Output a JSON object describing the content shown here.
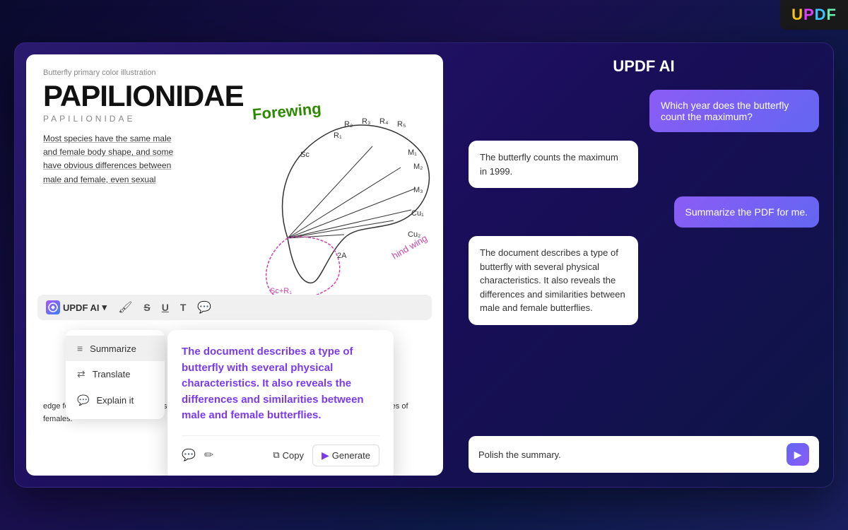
{
  "badge": {
    "u": "U",
    "p": "P",
    "d": "D",
    "f": "F"
  },
  "updf_ai_logo": "UPDF AI",
  "pdf": {
    "subtitle": "Butterfly primary color illustration",
    "title": "PAPILIONIDAE",
    "title_small": "PAPILIONIDAE",
    "body_text": "Most species have the same male and female body shape, and some have obvious differences between male and female, even sexual",
    "forewing_label": "Forewing",
    "hindwing_label": "hind wing",
    "bottom_text": "edge folds of hindwings, and them show differences due to seasons, and some species h multiple types of females."
  },
  "toolbar": {
    "brand_label": "UPDF AI",
    "dropdown_arrow": "▾"
  },
  "dropdown": {
    "items": [
      {
        "icon": "≡",
        "label": "Summarize"
      },
      {
        "icon": "⇄",
        "label": "Translate"
      },
      {
        "icon": "💬",
        "label": "Explain it"
      }
    ]
  },
  "tooltip": {
    "text": "The document describes a type of butterfly with several physical characteristics. It also reveals the differences and similarities between male and female butterflies.",
    "copy_label": "Copy",
    "generate_label": "Generate"
  },
  "ai": {
    "title": "UPDF AI",
    "messages": [
      {
        "type": "user",
        "text": "Which year does the butterfly count the maximum?"
      },
      {
        "type": "ai",
        "text": "The butterfly counts the maximum in 1999."
      },
      {
        "type": "user",
        "text": "Summarize the PDF for me."
      },
      {
        "type": "ai",
        "text": "The document describes a type of butterfly with several physical characteristics. It also reveals the differences and similarities between male and female butterflies."
      }
    ],
    "input_placeholder": "Polish the summary.",
    "input_value": "Polish the summary."
  }
}
